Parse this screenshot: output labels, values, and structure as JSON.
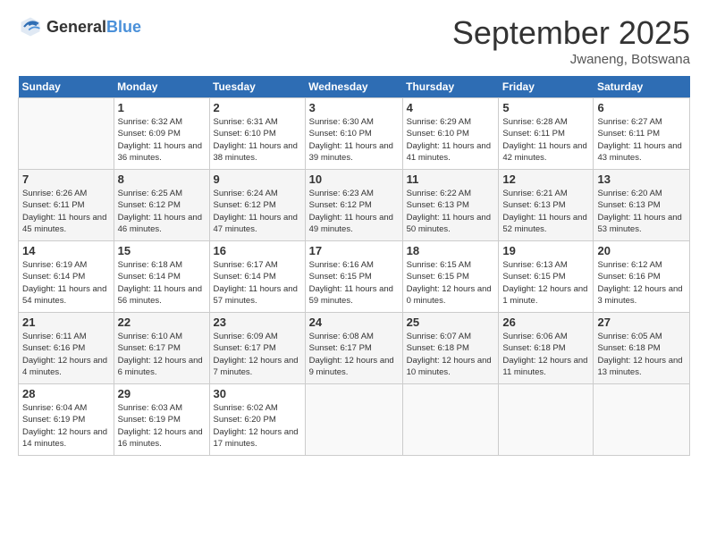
{
  "header": {
    "logo_general": "General",
    "logo_blue": "Blue",
    "title": "September 2025",
    "location": "Jwaneng, Botswana"
  },
  "days_of_week": [
    "Sunday",
    "Monday",
    "Tuesday",
    "Wednesday",
    "Thursday",
    "Friday",
    "Saturday"
  ],
  "weeks": [
    [
      {
        "day": "",
        "empty": true
      },
      {
        "day": "1",
        "sunrise": "Sunrise: 6:32 AM",
        "sunset": "Sunset: 6:09 PM",
        "daylight": "Daylight: 11 hours and 36 minutes."
      },
      {
        "day": "2",
        "sunrise": "Sunrise: 6:31 AM",
        "sunset": "Sunset: 6:10 PM",
        "daylight": "Daylight: 11 hours and 38 minutes."
      },
      {
        "day": "3",
        "sunrise": "Sunrise: 6:30 AM",
        "sunset": "Sunset: 6:10 PM",
        "daylight": "Daylight: 11 hours and 39 minutes."
      },
      {
        "day": "4",
        "sunrise": "Sunrise: 6:29 AM",
        "sunset": "Sunset: 6:10 PM",
        "daylight": "Daylight: 11 hours and 41 minutes."
      },
      {
        "day": "5",
        "sunrise": "Sunrise: 6:28 AM",
        "sunset": "Sunset: 6:11 PM",
        "daylight": "Daylight: 11 hours and 42 minutes."
      },
      {
        "day": "6",
        "sunrise": "Sunrise: 6:27 AM",
        "sunset": "Sunset: 6:11 PM",
        "daylight": "Daylight: 11 hours and 43 minutes."
      }
    ],
    [
      {
        "day": "7",
        "sunrise": "Sunrise: 6:26 AM",
        "sunset": "Sunset: 6:11 PM",
        "daylight": "Daylight: 11 hours and 45 minutes."
      },
      {
        "day": "8",
        "sunrise": "Sunrise: 6:25 AM",
        "sunset": "Sunset: 6:12 PM",
        "daylight": "Daylight: 11 hours and 46 minutes."
      },
      {
        "day": "9",
        "sunrise": "Sunrise: 6:24 AM",
        "sunset": "Sunset: 6:12 PM",
        "daylight": "Daylight: 11 hours and 47 minutes."
      },
      {
        "day": "10",
        "sunrise": "Sunrise: 6:23 AM",
        "sunset": "Sunset: 6:12 PM",
        "daylight": "Daylight: 11 hours and 49 minutes."
      },
      {
        "day": "11",
        "sunrise": "Sunrise: 6:22 AM",
        "sunset": "Sunset: 6:13 PM",
        "daylight": "Daylight: 11 hours and 50 minutes."
      },
      {
        "day": "12",
        "sunrise": "Sunrise: 6:21 AM",
        "sunset": "Sunset: 6:13 PM",
        "daylight": "Daylight: 11 hours and 52 minutes."
      },
      {
        "day": "13",
        "sunrise": "Sunrise: 6:20 AM",
        "sunset": "Sunset: 6:13 PM",
        "daylight": "Daylight: 11 hours and 53 minutes."
      }
    ],
    [
      {
        "day": "14",
        "sunrise": "Sunrise: 6:19 AM",
        "sunset": "Sunset: 6:14 PM",
        "daylight": "Daylight: 11 hours and 54 minutes."
      },
      {
        "day": "15",
        "sunrise": "Sunrise: 6:18 AM",
        "sunset": "Sunset: 6:14 PM",
        "daylight": "Daylight: 11 hours and 56 minutes."
      },
      {
        "day": "16",
        "sunrise": "Sunrise: 6:17 AM",
        "sunset": "Sunset: 6:14 PM",
        "daylight": "Daylight: 11 hours and 57 minutes."
      },
      {
        "day": "17",
        "sunrise": "Sunrise: 6:16 AM",
        "sunset": "Sunset: 6:15 PM",
        "daylight": "Daylight: 11 hours and 59 minutes."
      },
      {
        "day": "18",
        "sunrise": "Sunrise: 6:15 AM",
        "sunset": "Sunset: 6:15 PM",
        "daylight": "Daylight: 12 hours and 0 minutes."
      },
      {
        "day": "19",
        "sunrise": "Sunrise: 6:13 AM",
        "sunset": "Sunset: 6:15 PM",
        "daylight": "Daylight: 12 hours and 1 minute."
      },
      {
        "day": "20",
        "sunrise": "Sunrise: 6:12 AM",
        "sunset": "Sunset: 6:16 PM",
        "daylight": "Daylight: 12 hours and 3 minutes."
      }
    ],
    [
      {
        "day": "21",
        "sunrise": "Sunrise: 6:11 AM",
        "sunset": "Sunset: 6:16 PM",
        "daylight": "Daylight: 12 hours and 4 minutes."
      },
      {
        "day": "22",
        "sunrise": "Sunrise: 6:10 AM",
        "sunset": "Sunset: 6:17 PM",
        "daylight": "Daylight: 12 hours and 6 minutes."
      },
      {
        "day": "23",
        "sunrise": "Sunrise: 6:09 AM",
        "sunset": "Sunset: 6:17 PM",
        "daylight": "Daylight: 12 hours and 7 minutes."
      },
      {
        "day": "24",
        "sunrise": "Sunrise: 6:08 AM",
        "sunset": "Sunset: 6:17 PM",
        "daylight": "Daylight: 12 hours and 9 minutes."
      },
      {
        "day": "25",
        "sunrise": "Sunrise: 6:07 AM",
        "sunset": "Sunset: 6:18 PM",
        "daylight": "Daylight: 12 hours and 10 minutes."
      },
      {
        "day": "26",
        "sunrise": "Sunrise: 6:06 AM",
        "sunset": "Sunset: 6:18 PM",
        "daylight": "Daylight: 12 hours and 11 minutes."
      },
      {
        "day": "27",
        "sunrise": "Sunrise: 6:05 AM",
        "sunset": "Sunset: 6:18 PM",
        "daylight": "Daylight: 12 hours and 13 minutes."
      }
    ],
    [
      {
        "day": "28",
        "sunrise": "Sunrise: 6:04 AM",
        "sunset": "Sunset: 6:19 PM",
        "daylight": "Daylight: 12 hours and 14 minutes."
      },
      {
        "day": "29",
        "sunrise": "Sunrise: 6:03 AM",
        "sunset": "Sunset: 6:19 PM",
        "daylight": "Daylight: 12 hours and 16 minutes."
      },
      {
        "day": "30",
        "sunrise": "Sunrise: 6:02 AM",
        "sunset": "Sunset: 6:20 PM",
        "daylight": "Daylight: 12 hours and 17 minutes."
      },
      {
        "day": "",
        "empty": true
      },
      {
        "day": "",
        "empty": true
      },
      {
        "day": "",
        "empty": true
      },
      {
        "day": "",
        "empty": true
      }
    ]
  ]
}
